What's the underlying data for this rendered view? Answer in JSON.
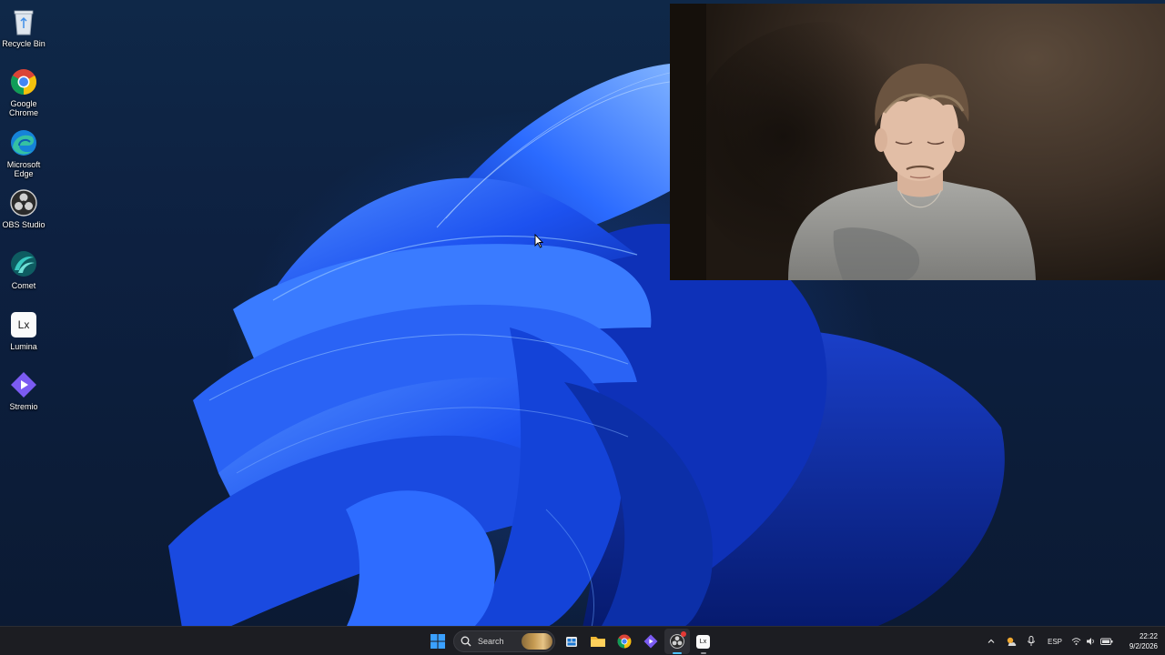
{
  "desktop": {
    "icons": [
      {
        "label": "Recycle Bin",
        "icon": "recycle-bin-icon"
      },
      {
        "label": "Google\nChrome",
        "icon": "chrome-icon"
      },
      {
        "label": "Microsoft\nEdge",
        "icon": "edge-icon"
      },
      {
        "label": "OBS Studio",
        "icon": "obs-icon"
      },
      {
        "label": "Comet",
        "icon": "comet-icon"
      },
      {
        "label": "Lumina",
        "icon": "lumina-icon",
        "glyph_text": "Lx"
      },
      {
        "label": "Stremio",
        "icon": "stremio-icon"
      }
    ]
  },
  "taskbar": {
    "search_label": "Search",
    "apps": [
      {
        "name": "start",
        "icon": "windows-start-icon"
      },
      {
        "name": "task-view",
        "icon": "task-view-icon"
      },
      {
        "name": "file-explorer",
        "icon": "folder-icon"
      },
      {
        "name": "chrome",
        "icon": "chrome-icon"
      },
      {
        "name": "stremio",
        "icon": "stremio-icon"
      },
      {
        "name": "obs",
        "icon": "obs-icon",
        "active": true
      },
      {
        "name": "lumina",
        "icon": "lumina-icon",
        "glyph_text": "Lx"
      }
    ],
    "tray": {
      "language": "ESP",
      "time": "22:22",
      "date": "9/2/2026"
    }
  },
  "colors": {
    "taskbar_bg": "#1c1d22",
    "wallpaper_blue": "#1f5eff",
    "accent": "#4cc2ff"
  }
}
